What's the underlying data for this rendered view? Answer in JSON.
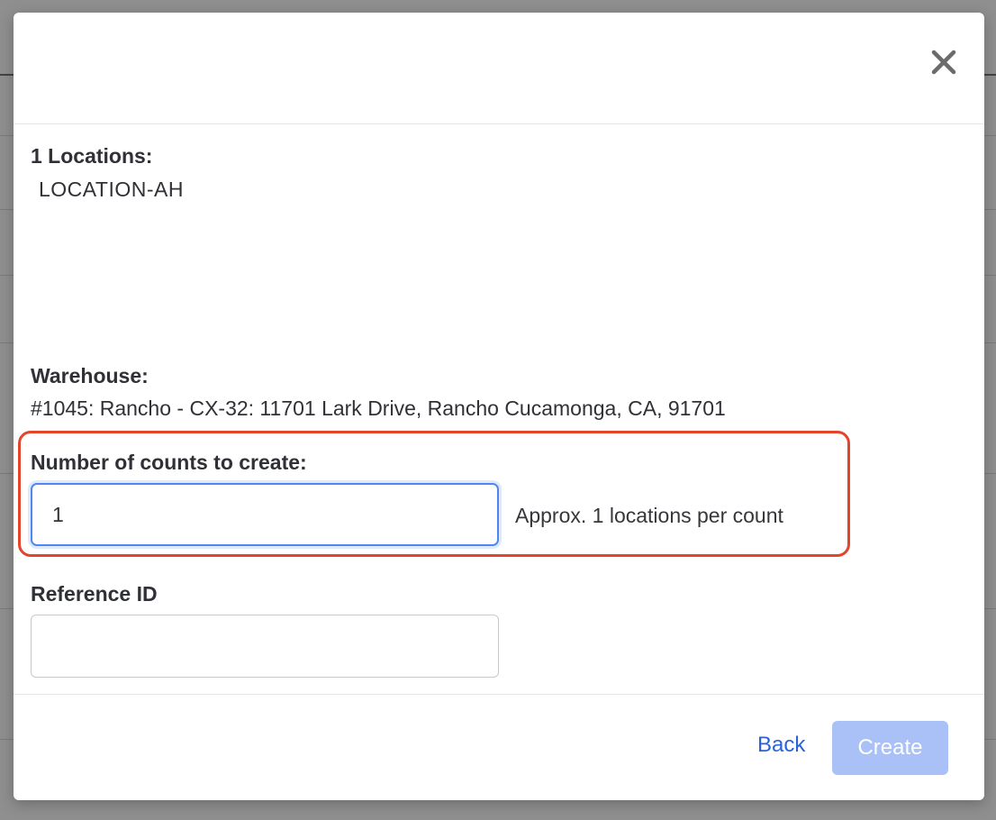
{
  "locations": {
    "label": "1 Locations:",
    "value": "LOCATION-AH"
  },
  "warehouse": {
    "label": "Warehouse:",
    "value": "#1045: Rancho - CX-32: 11701 Lark Drive, Rancho Cucamonga, CA, 91701"
  },
  "counts": {
    "label": "Number of counts to create:",
    "value": "1",
    "approx": "Approx. 1 locations per count"
  },
  "reference": {
    "label": "Reference ID",
    "value": ""
  },
  "footer": {
    "back_label": "Back",
    "create_label": "Create"
  },
  "icons": {
    "close": "close-icon"
  },
  "colors": {
    "highlight": "#e2442c",
    "link": "#2a63d8",
    "create_disabled": "#a9c1f7",
    "input_focus": "#4f86f0"
  }
}
